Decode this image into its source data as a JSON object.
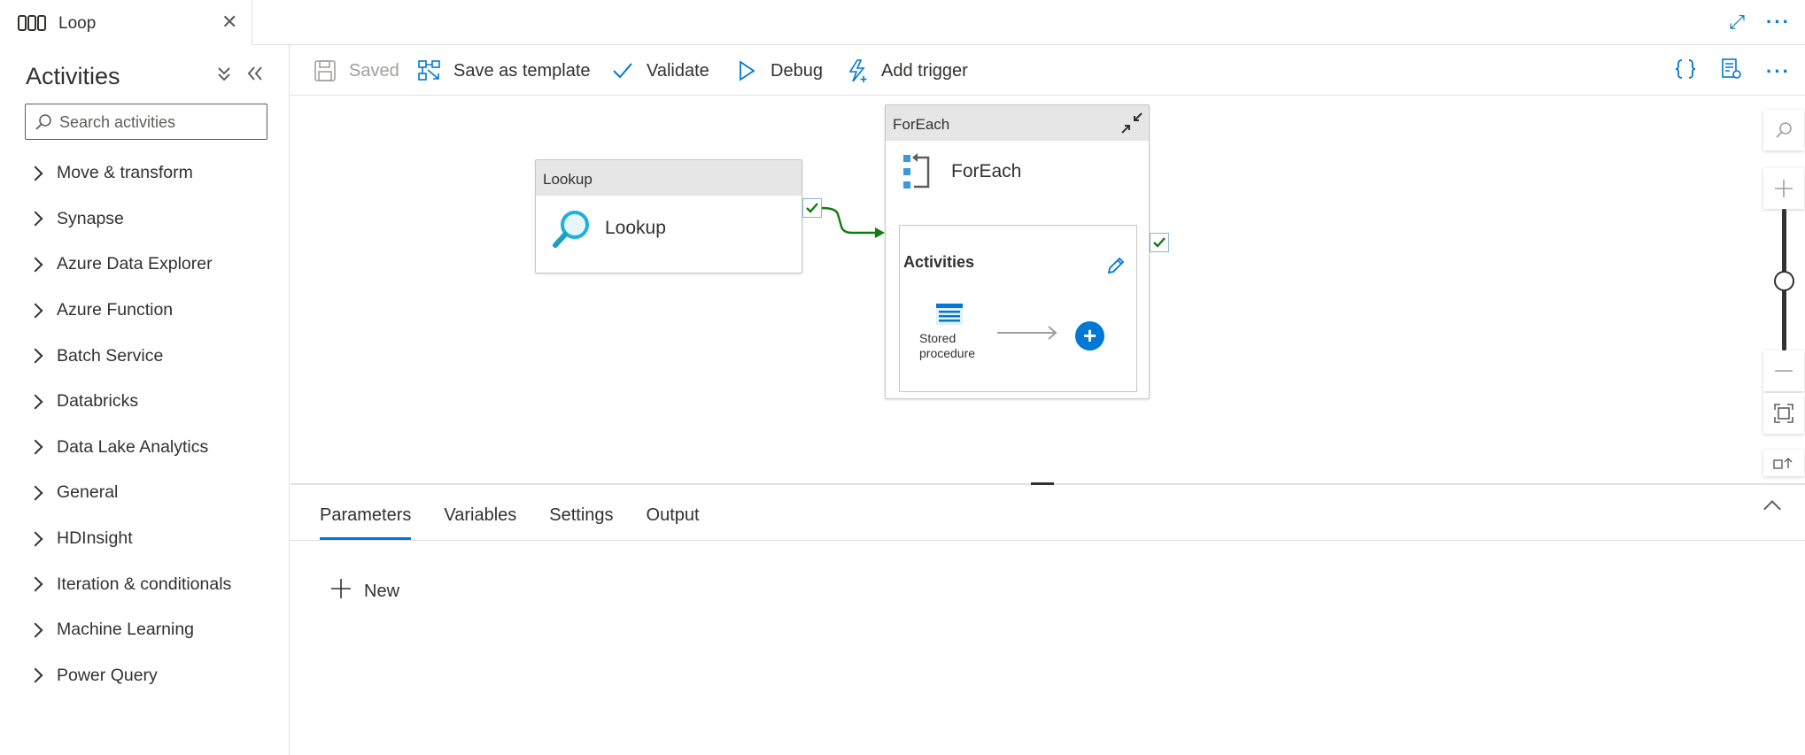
{
  "tab": {
    "title": "Loop",
    "close": "✕"
  },
  "tabstrip": {
    "expand": "⤢",
    "more": "···"
  },
  "sidebar": {
    "title": "Activities",
    "search_placeholder": "Search activities",
    "categories": [
      "Move & transform",
      "Synapse",
      "Azure Data Explorer",
      "Azure Function",
      "Batch Service",
      "Databricks",
      "Data Lake Analytics",
      "General",
      "HDInsight",
      "Iteration & conditionals",
      "Machine Learning",
      "Power Query"
    ]
  },
  "toolbar": {
    "saved": "Saved",
    "save_template": "Save as template",
    "validate": "Validate",
    "debug": "Debug",
    "add_trigger": "Add trigger",
    "more": "···"
  },
  "canvas": {
    "lookup": {
      "header": "Lookup",
      "label": "Lookup"
    },
    "foreach": {
      "header": "ForEach",
      "label": "ForEach",
      "inner_title": "Activities",
      "stored_procedure": "Stored procedure",
      "add": "+"
    }
  },
  "bottom": {
    "tabs": [
      "Parameters",
      "Variables",
      "Settings",
      "Output"
    ],
    "active_tab": "Parameters",
    "new_label": "New"
  },
  "colors": {
    "accent": "#0078d4",
    "success": "#107c10",
    "border": "#e1dfdd"
  }
}
